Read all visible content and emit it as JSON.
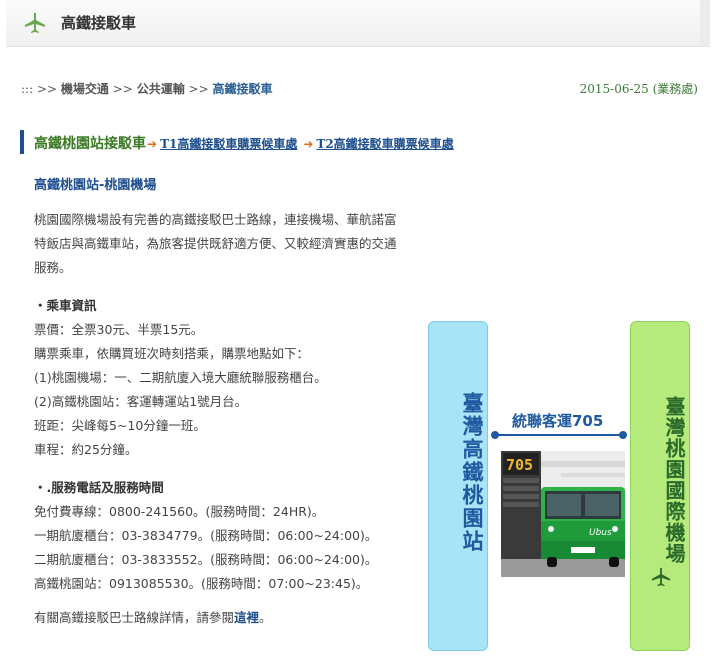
{
  "header": {
    "title": "高鐵接駁車",
    "icon": "plane-icon"
  },
  "breadcrumb": {
    "prefix": ":::",
    "sep": ">>",
    "items": [
      "機場交通",
      "公共運輸",
      "高鐵接駁車"
    ]
  },
  "date": "2015-06-25 (業務處)",
  "section": {
    "active_tab": "高鐵桃園站接駁車",
    "tabs": [
      "T1高鐵接駁車購票候車處",
      "T2高鐵接駁車購票候車處"
    ],
    "accent": "#1f4f8f"
  },
  "subtitle": "高鐵桃園站-桃園機場",
  "intro_lines": [
    "桃園國際機場設有完善的高鐵接駁巴士路線，連接機場、華航諾富",
    "特飯店與高鐵車站，為旅客提供既舒適方便、又較經濟實惠的交通",
    "服務。"
  ],
  "ride_info": {
    "heading": "・乘車資訊",
    "lines": [
      "票價：全票30元、半票15元。",
      "購票乘車，依購買班次時刻搭乘，購票地點如下：",
      "(1)桃園機場：一、二期航廈入境大廳統聯服務櫃台。",
      "(2)高鐵桃園站：客運轉運站1號月台。",
      "班距：尖峰每5~10分鐘一班。",
      "車程：約25分鐘。"
    ]
  },
  "contact_info": {
    "heading": "・.服務電話及服務時間",
    "lines": [
      "免付費專線：0800-241560。(服務時間：24HR)。",
      "一期航廈櫃台：03-3834779。(服務時間：06:00~24:00)。",
      "二期航廈櫃台：03-3833552。(服務時間：06:00~24:00)。",
      "高鐵桃園站：0913085530。(服務時間：07:00~23:45)。"
    ]
  },
  "footer": {
    "text": "有關高鐵接駁巴士路線詳情，請參閱",
    "link": "這裡",
    "end": "。"
  },
  "diagram": {
    "left_station": "臺灣高鐵桃園站",
    "right_station": "臺灣桃園國際機場",
    "route": "統聯客運705",
    "bus_number": "705",
    "bus_logo": "Ubus",
    "colors": {
      "left": "#a8e3f7",
      "right": "#b6ea7c",
      "route": "#1f5aa0"
    }
  }
}
